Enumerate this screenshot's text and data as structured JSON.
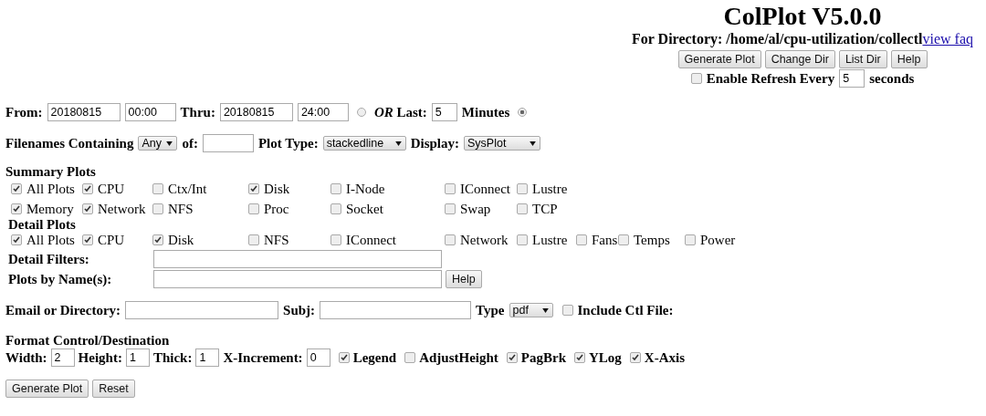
{
  "header": {
    "title": "ColPlot V5.0.0",
    "directory": "For Directory: /home/al/cpu-utilization/collectl",
    "faq_link": "view faq",
    "buttons": [
      "Generate Plot",
      "Change Dir",
      "List Dir",
      "Help"
    ],
    "refresh": {
      "checked": false,
      "label": "Enable Refresh Every",
      "value": "5",
      "unit": "seconds"
    }
  },
  "time": {
    "from_label": "From:",
    "from_date": "20180815",
    "from_time": "00:00",
    "thru_label": "Thru:",
    "thru_date": "20180815",
    "thru_time": "24:00",
    "range_radio": {
      "selected": false
    },
    "last_label": "*OR* Last:",
    "last_value": "5",
    "unit": "Minutes",
    "last_radio": {
      "selected": true
    }
  },
  "filter_row": {
    "label": "Filenames Containing",
    "match": "Any",
    "of_label": "of:",
    "plot_type_label": "Plot Type:",
    "plot_type": "stackedline",
    "display_label": "Display:",
    "display": "SysPlot"
  },
  "summary_plots": {
    "title": "Summary Plots",
    "items": [
      {
        "label": "All Plots",
        "checked": true
      },
      {
        "label": "CPU",
        "checked": true
      },
      {
        "label": "Ctx/Int",
        "checked": false
      },
      {
        "label": "Disk",
        "checked": true
      },
      {
        "label": "I-Node",
        "checked": false
      },
      {
        "label": "IConnect",
        "checked": false
      },
      {
        "label": "Lustre",
        "checked": false
      },
      {
        "label": "Memory",
        "checked": true
      },
      {
        "label": "Network",
        "checked": true
      },
      {
        "label": "NFS",
        "checked": false
      },
      {
        "label": "Proc",
        "checked": false
      },
      {
        "label": "Socket",
        "checked": false
      },
      {
        "label": "Swap",
        "checked": false
      },
      {
        "label": "TCP",
        "checked": false
      }
    ]
  },
  "detail_plots": {
    "title": "Detail Plots",
    "items": [
      {
        "label": "All Plots",
        "checked": true
      },
      {
        "label": "CPU",
        "checked": true
      },
      {
        "label": "Disk",
        "checked": true
      },
      {
        "label": "NFS",
        "checked": false
      },
      {
        "label": "IConnect",
        "checked": false
      },
      {
        "label": "Network",
        "checked": false
      },
      {
        "label": "Lustre",
        "checked": false
      },
      {
        "label": "Fans",
        "checked": false
      },
      {
        "label": "Temps",
        "checked": false
      },
      {
        "label": "Power",
        "checked": false
      }
    ]
  },
  "detail_filters_label": "Detail Filters:",
  "plots_by_name_label": "Plots by Name(s):",
  "plots_help_button": "Help",
  "output": {
    "email_label": "Email or Directory:",
    "subj_label": "Subj:",
    "type_label": "Type",
    "type": "pdf",
    "include_ctl": {
      "label": "Include Ctl File:",
      "checked": false
    }
  },
  "format": {
    "title": "Format Control/Destination",
    "fields": [
      {
        "label": "Width:",
        "value": "2"
      },
      {
        "label": "Height:",
        "value": "1"
      },
      {
        "label": "Thick:",
        "value": "1"
      },
      {
        "label": "X-Increment:",
        "value": "0"
      }
    ],
    "options": [
      {
        "label": "Legend",
        "checked": true
      },
      {
        "label": "AdjustHeight",
        "checked": false
      },
      {
        "label": "PagBrk",
        "checked": true
      },
      {
        "label": "YLog",
        "checked": true
      },
      {
        "label": "X-Axis",
        "checked": true
      }
    ]
  },
  "buttons": [
    "Generate Plot",
    "Reset"
  ]
}
